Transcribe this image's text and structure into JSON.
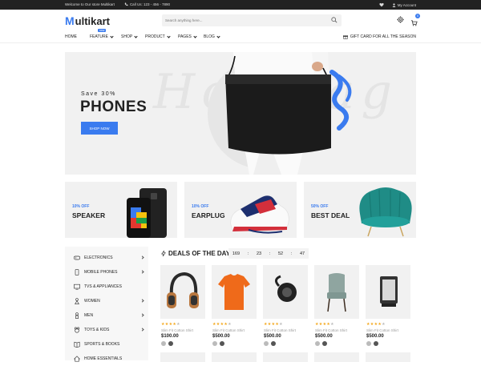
{
  "topbar": {
    "welcome": "Welcome to Our store Multikart",
    "call": "Call Us: 123 - 456 - 7890",
    "account": "My Account"
  },
  "logo": {
    "first": "M",
    "rest": "ultikart"
  },
  "search": {
    "placeholder": "Search anything here..."
  },
  "cart": {
    "count": "0"
  },
  "nav": {
    "items": [
      "HOME",
      "FEATURE",
      "SHOP",
      "PRODUCT",
      "PAGES",
      "BLOG"
    ],
    "feature_badge": "new",
    "gift": "GIFT CARD FOR ALL THE SEASON"
  },
  "hero": {
    "save": "Save 30%",
    "title": "PHONES",
    "button": "SHOP NOW",
    "bg_text": "Hot Bag"
  },
  "promos": [
    {
      "off": "10% OFF",
      "name": "SPEAKER"
    },
    {
      "off": "10% OFF",
      "name": "EARPLUG"
    },
    {
      "off": "50% OFF",
      "name": "BEST DEAL"
    }
  ],
  "categories": [
    {
      "label": "ELECTRONICS",
      "icon": "gamepad-icon"
    },
    {
      "label": "MOBILE PHONES",
      "icon": "phone-icon"
    },
    {
      "label": "TVS & APPLIANCES",
      "icon": "tv-icon"
    },
    {
      "label": "WOMEN",
      "icon": "woman-icon"
    },
    {
      "label": "MEN",
      "icon": "man-icon"
    },
    {
      "label": "TOYS & KIDS",
      "icon": "toy-icon"
    },
    {
      "label": "SPORTS & BOOKS",
      "icon": "book-icon"
    },
    {
      "label": "HOME ESSENTIALS",
      "icon": "home-icon"
    }
  ],
  "deals": {
    "title": "DEALS OF THE DAY",
    "timer": [
      "169",
      ":",
      "23",
      ":",
      "52",
      ":",
      "47"
    ]
  },
  "products": [
    {
      "name": "Slim Fit Cotton Shirt",
      "price": "$100.00",
      "rating": 4,
      "image": "headphones"
    },
    {
      "name": "Slim Fit Cotton Shirt",
      "price": "$500.00",
      "rating": 4,
      "image": "orange-tshirt"
    },
    {
      "name": "Slim Fit Cotton Shirt",
      "price": "$500.00",
      "rating": 4,
      "image": "earbud"
    },
    {
      "name": "Slim Fit Cotton Shirt",
      "price": "$500.00",
      "rating": 4,
      "image": "chair"
    },
    {
      "name": "Slim Fit Cotton Shirt",
      "price": "$500.00",
      "rating": 4,
      "image": "speaker-box"
    }
  ],
  "colors": {
    "accent": "#3a7bef",
    "star": "#f4a81c",
    "topbar": "#222222"
  }
}
